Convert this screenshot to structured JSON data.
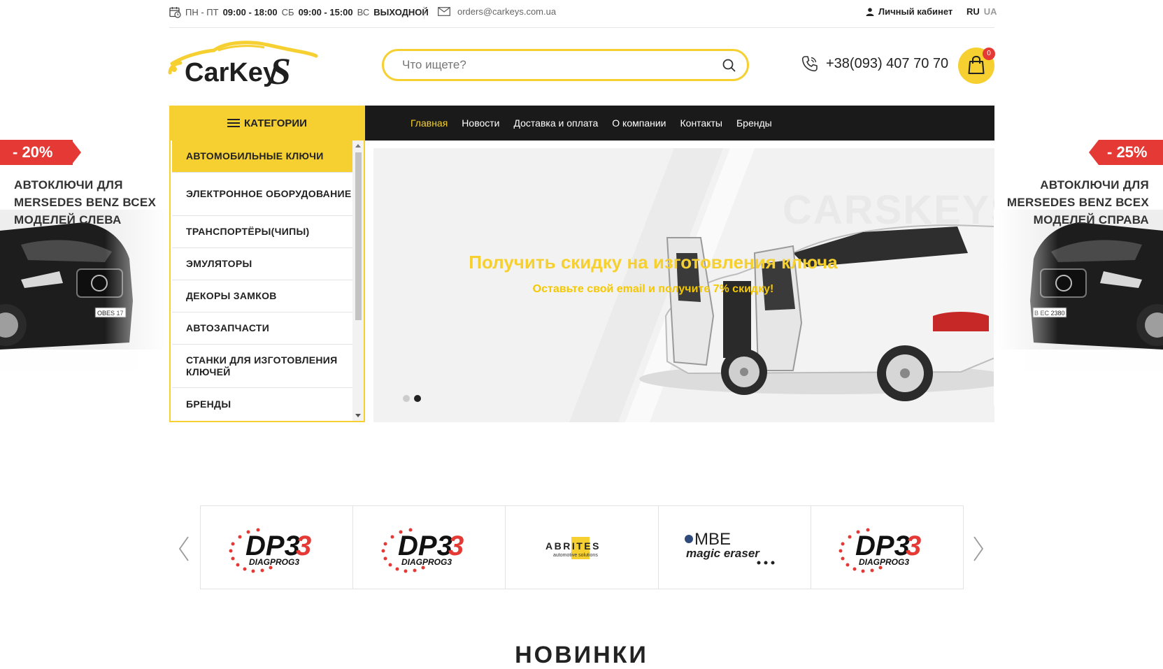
{
  "topbar": {
    "hours": {
      "d1": "ПН - ПТ",
      "t1": "09:00 - 18:00",
      "d2": "СБ",
      "t2": "09:00 - 15:00",
      "d3": "ВС",
      "t3": "ВЫХОДНОЙ"
    },
    "email": "orders@carkeys.com.ua",
    "account": "Личный кабинет",
    "lang_active": "RU",
    "lang_other": "UA"
  },
  "header": {
    "logo_text": "CarKeyS",
    "search_placeholder": "Что ищете?",
    "phone": "+38(093) 407 70 70",
    "cart_count": "0"
  },
  "nav": {
    "categories_label": "КАТЕГОРИИ",
    "links": [
      "Главная",
      "Новости",
      "Доставка и оплата",
      "О компании",
      "Контакты",
      "Бренды"
    ]
  },
  "categories": [
    "АВТОМОБИЛЬНЫЕ КЛЮЧИ",
    "ЭЛЕКТРОННОЕ ОБОРУДОВАНИЕ",
    "ТРАНСПОРТЁРЫ(ЧИПЫ)",
    "ЭМУЛЯТОРЫ",
    "ДЕКОРЫ ЗАМКОВ",
    "АВТОЗАПЧАСТИ",
    "СТАНКИ ДЛЯ ИЗГОТОВЛЕНИЯ КЛЮЧЕЙ",
    "БРЕНДЫ"
  ],
  "slider": {
    "watermark": "CARSKEYS",
    "title": "Получить скидку на изготовления ключа",
    "subtitle": "Оставьте свой email и получите 7% скидку!",
    "active_slide": 2,
    "slide_count": 2
  },
  "promo_left": {
    "discount": "- 20%",
    "lines": [
      "АВТОКЛЮЧИ ДЛЯ",
      "MERSEDES BENZ ВСЕХ",
      "МОДЕЛЕЙ СЛЕВА"
    ],
    "plate": "OBES 17"
  },
  "promo_right": {
    "discount": "- 25%",
    "lines": [
      "АВТОКЛЮЧИ ДЛЯ",
      "MERSEDES BENZ ВСЕХ",
      "МОДЕЛЕЙ СПРАВА"
    ],
    "plate": "B EC 2380"
  },
  "brands": [
    {
      "name": "DP3",
      "sub": "DIAGPROG3"
    },
    {
      "name": "DP3",
      "sub": "DIAGPROG3"
    },
    {
      "name": "ABRITES",
      "sub": "automotive solutions"
    },
    {
      "name": "MBE",
      "sub": "magic eraser"
    },
    {
      "name": "DP3",
      "sub": "DIAGPROG3"
    }
  ],
  "section_heading": "НОВИНКИ",
  "colors": {
    "accent": "#f5d030",
    "nav_bg": "#1a1a1a",
    "sale": "#e53935"
  }
}
